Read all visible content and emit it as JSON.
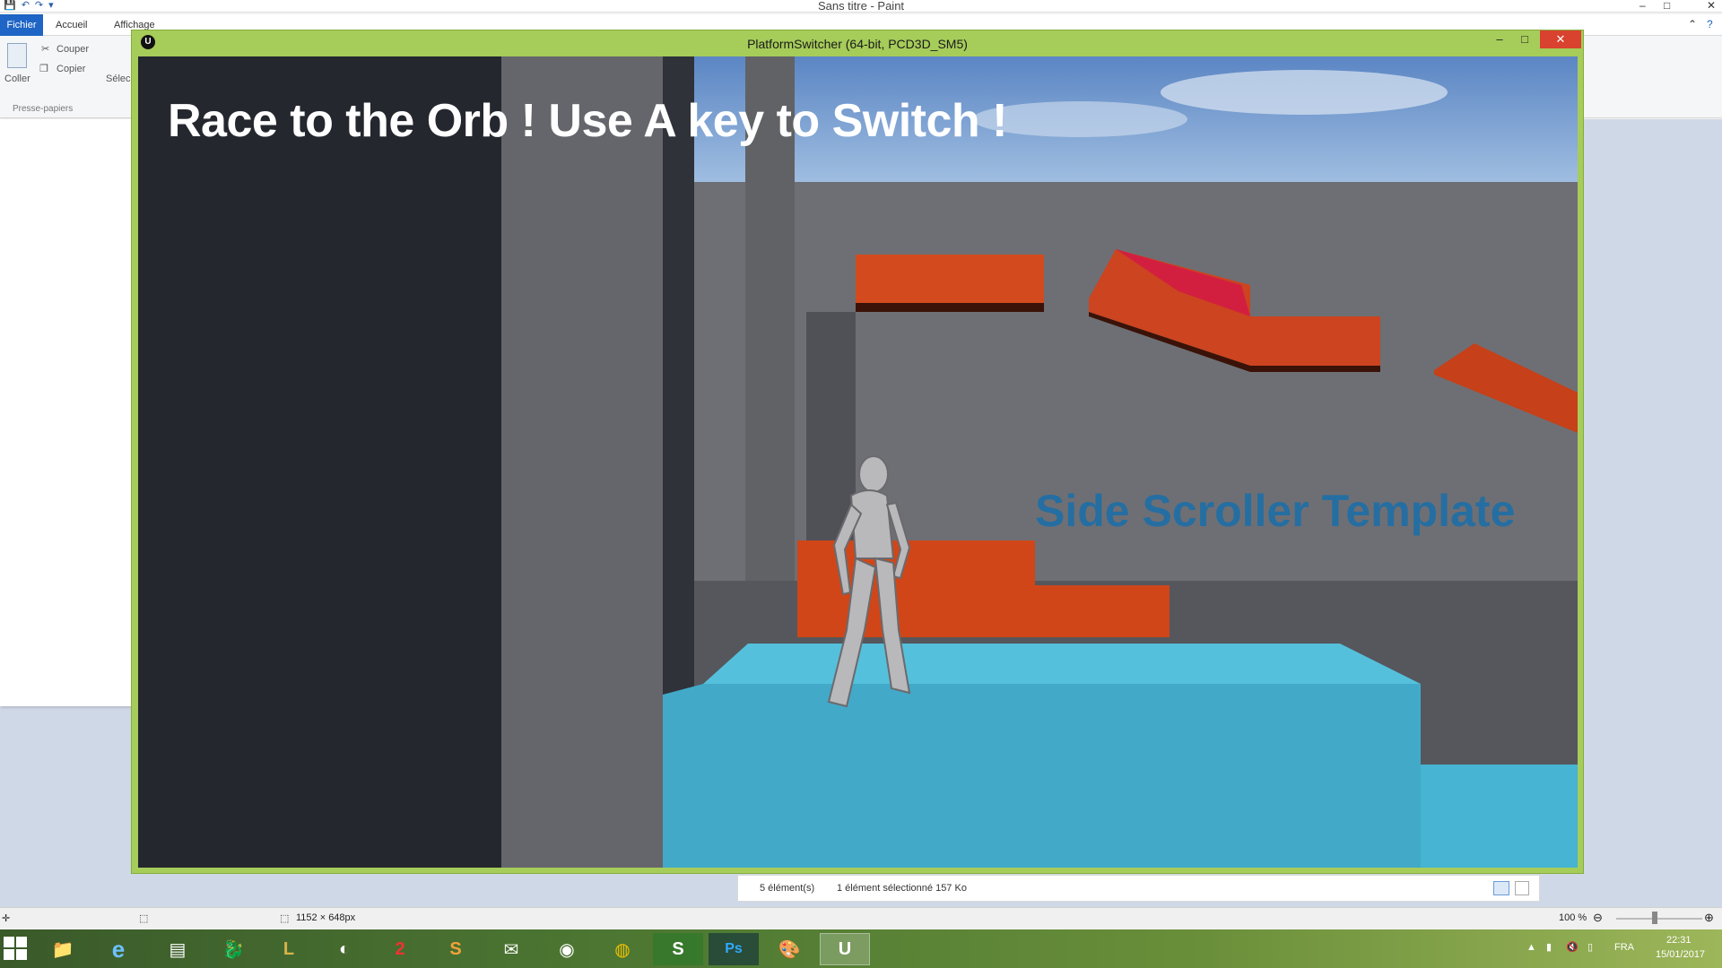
{
  "paint": {
    "window_title": "Sans titre - Paint",
    "tabs": [
      "Fichier",
      "Accueil",
      "Affichage"
    ],
    "ribbon": {
      "paste_label": "Coller",
      "cut_label": "Couper",
      "copy_label": "Copier",
      "select_label": "Sélec",
      "clipboard_group": "Presse-papiers"
    },
    "status": {
      "dimensions": "1152 × 648px",
      "zoom": "100 %"
    }
  },
  "explorer_status": {
    "items": "5 élément(s)",
    "selected": "1 élément sélectionné  157 Ko"
  },
  "game_window": {
    "title": "PlatformSwitcher (64-bit, PCD3D_SM5)",
    "logo_label": "U",
    "minimize": "–",
    "maximize": "□",
    "close": "✕",
    "hud_text": "Race to the Orb ! Use A key to Switch !",
    "sign_text": "Side Scroller Template"
  },
  "taskbar": {
    "apps": [
      "file-explorer-icon",
      "internet-explorer-icon",
      "document-app-icon",
      "dragon-app-icon",
      "league-of-legends-icon",
      "steam-icon",
      "app-2-icon",
      "sublime-text-icon",
      "mail-icon",
      "camera-app-icon",
      "chrome-icon",
      "store-app-icon",
      "photoshop-icon",
      "paint-icon",
      "unreal-engine-icon"
    ],
    "app_glyphs": [
      "📁",
      "e",
      "▤",
      "🐉",
      "L",
      "◐",
      "2",
      "S",
      "✉",
      "◉",
      "◍",
      "S",
      "Ps",
      "🎨",
      "U"
    ],
    "language": "FRA",
    "time": "22:31",
    "date": "15/01/2017"
  },
  "colors": {
    "game_border": "#a6cc5a",
    "close_button": "#d9422e",
    "platform_orange": "#d24a1e",
    "platform_blue": "#46b4d2",
    "sign_text": "#1e6ea8"
  }
}
